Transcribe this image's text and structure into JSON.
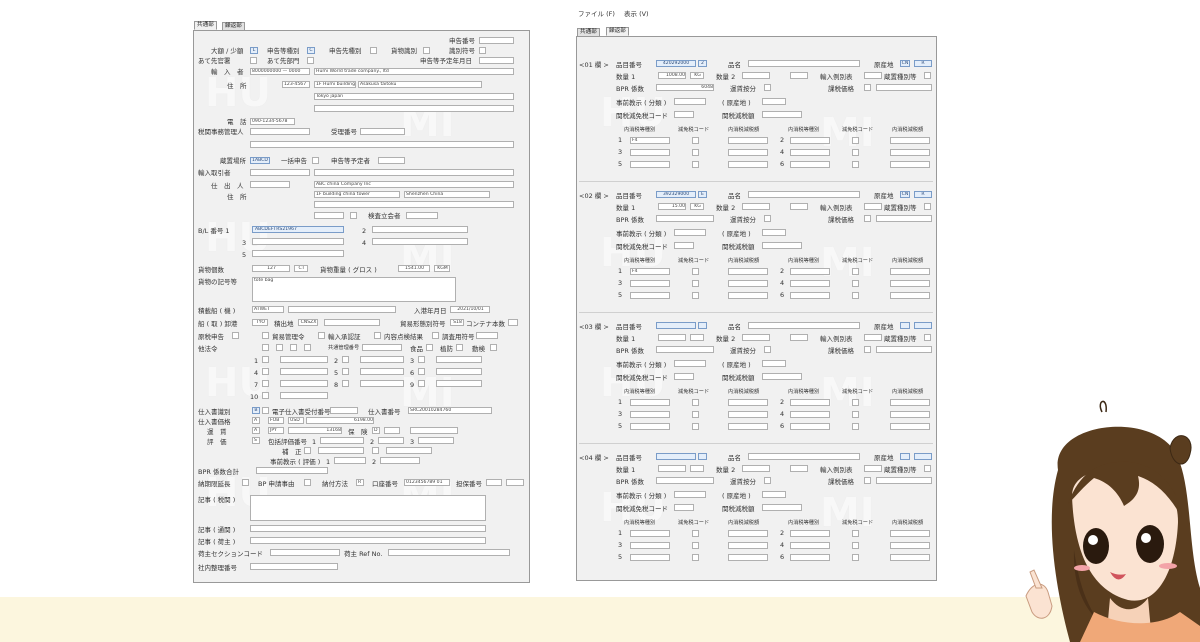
{
  "app": {
    "menu": [
      "ファイル (F)",
      "表示 (V)"
    ],
    "tabs": [
      "共通部",
      "繰返部"
    ]
  },
  "left": {
    "tabs": [
      "共通部",
      "繰返部"
    ],
    "labels": {
      "declaration_no": "申告番号",
      "classification": "大額 / 少額",
      "decl_type": "申告等種別",
      "decl_dest_type": "申告先種別",
      "cargo_id": "貨物識別",
      "id_symbol": "識別符号",
      "consignee_dept": "あて先官署",
      "consignee_div": "あて先部門",
      "decl_planned_date": "申告等予定年月日",
      "importer": "輸　入　者",
      "address": "住　所",
      "phone": "電　話",
      "customs_admin": "税関事務管理人",
      "receipt_no": "受理番号",
      "storage": "蔵置場所",
      "bulk_decl": "一括申告",
      "scheduled_declarant": "申告等予定者",
      "import_trader": "輸入取引者",
      "shipper": "仕　出　人",
      "shipper_address": "住　所",
      "inspector": "検査立会者",
      "bl_no": "B/L 番号 1",
      "pkg_count": "貨物個数",
      "gross_weight": "貨物重量 ( グロス )",
      "marks": "貨物の記号等",
      "vessel": "積載船 ( 機 )",
      "arrival_date": "入港年月日",
      "port": "船 ( 取 ) 卸港",
      "loading_port": "積出地",
      "cargo_mark": "貿易形態別符号",
      "container_count": "コンテナ本数",
      "original_decl": "原税申告",
      "trade_mgmt": "貿易管理令",
      "import_approval": "輸入承認証",
      "inspection_result": "内容点検結果",
      "survey": "調査用符号",
      "other_law": "他法令",
      "common_mgmt": "共通管理番号",
      "food": "食品",
      "plant": "植防",
      "animal": "動検",
      "invoice_id": "仕入書識別",
      "e_invoice_no": "電子仕入書受付番号",
      "invoice_no": "仕入書番号",
      "invoice_price": "仕入書価格",
      "freight": "運　賃",
      "insurance": "保　険",
      "valuation": "評　価",
      "bulk_valuation_no": "包括評価番号",
      "correction": "補　正",
      "prior_teaching": "事前教示 ( 評価 )",
      "bpr_total": "BPR 係数合計",
      "deferral": "納期限延長",
      "bp_reason": "BP 申請事由",
      "payment_method": "納付方法",
      "account_no": "口座番号",
      "security_no": "担保番号",
      "remarks_tax": "記事 ( 税関 )",
      "remarks_customs": "記事 ( 通関 )",
      "remarks_consignee": "記事 ( 荷主 )",
      "consignee_section": "荷主セクションコード",
      "consignee_ref": "荷主 Ref No.",
      "internal_no": "社内整理番号"
    },
    "values": {
      "classification": "L",
      "decl_type": "C",
      "importer_code": "8000000000  —  0000",
      "importer_name": "Humi World trade company., ltd",
      "postal": "123-4567",
      "addr1": "1F Humi building",
      "addr2": "Asakusa taitoku",
      "addr3": "Tokyo japan",
      "phone": "090-1234-5678",
      "storage": "1ABCD",
      "shipper_name": "ABC china Company Inc",
      "shipper_addr1": "1F building china tower",
      "shipper_addr2": "Shenzhen China",
      "bl1": "ABCDEFTRS21967",
      "pkg_count": "127",
      "pkg_unit": "CT",
      "gross_weight": "1541.00",
      "weight_unit": "KGM",
      "marks": "tote bag",
      "vessel_code": "ATWET",
      "arrival_date": "2021/10/01",
      "port": "TYO",
      "loading_port": "CNSZX",
      "cargo_mark": "S18",
      "invoice_id": "B",
      "invoice_no": "SRC20010284760",
      "price_terms": "A",
      "price_cond": "FOB",
      "currency": "USD",
      "price": "6198.00",
      "freight_flag": "A",
      "freight_cur": "JPY",
      "freight_amt": "13168",
      "insurance_flag": "D",
      "valuation_flag": "S",
      "payment_method": "R",
      "account_no": "0123456789 01"
    },
    "other_law_nums": [
      "1",
      "2",
      "3",
      "4",
      "5",
      "6",
      "7",
      "8",
      "9",
      "10"
    ],
    "bl_nums": [
      "2",
      "3",
      "4",
      "5"
    ],
    "valuation_nums": [
      "1",
      "2",
      "3"
    ],
    "prior_nums": [
      "1",
      "2"
    ]
  },
  "right": {
    "menu": [
      "ファイル (F)",
      "表示 (V)"
    ],
    "tabs": [
      "共通部",
      "繰返部"
    ],
    "col_labels": {
      "item_code": "品目番号",
      "item_name": "品名",
      "origin": "原産地",
      "qty1": "数量 1",
      "qty2": "数量 2",
      "import_table": "輸入例別表",
      "storage_type": "蔵置種別等",
      "bpr": "BPR 係数",
      "freight_div": "運賃按分",
      "taxable_price": "課税価格",
      "prior_class": "事前教示 ( 分類 )",
      "prior_origin": "( 原産地 )",
      "tariff_code": "関税減免税コード",
      "tariff_amt": "関税減税額",
      "inner_tax_type": "内消税等種別",
      "exemption_code": "減免税コード",
      "inner_tax_amt": "内消税減税額"
    },
    "rows_left": [
      "1",
      "3",
      "5"
    ],
    "rows_right": [
      "2",
      "4",
      "6"
    ],
    "sections": [
      {
        "title": "<01 欄 >",
        "item_code": "420292000",
        "item_flag": "2",
        "origin": "CN",
        "origin_flag": "R",
        "qty1": "1008.00",
        "qty1_unit": "KG",
        "bpr": "6048",
        "tax_row1": "F4"
      },
      {
        "title": "<02 欄 >",
        "item_code": "392329000",
        "item_flag": "E",
        "origin": "CN",
        "origin_flag": "R",
        "qty1": "15.00",
        "qty1_unit": "KG",
        "bpr": "",
        "tax_row1": "F4"
      },
      {
        "title": "<03 欄 >",
        "item_code": "",
        "item_flag": "",
        "origin": "",
        "origin_flag": "",
        "qty1": "",
        "qty1_unit": "",
        "bpr": "",
        "tax_row1": ""
      },
      {
        "title": "<04 欄 >",
        "item_code": "",
        "item_flag": "",
        "origin": "",
        "origin_flag": "",
        "qty1": "",
        "qty1_unit": "",
        "bpr": "",
        "tax_row1": ""
      }
    ]
  },
  "watermarks": [
    "HU",
    "MI"
  ],
  "colors": {
    "panel_bg": "#f1f1f1",
    "code_bg": "#e4eefa",
    "band": "#fcf6de",
    "hair": "#5a3d1f",
    "shirt": "#f0a878"
  }
}
